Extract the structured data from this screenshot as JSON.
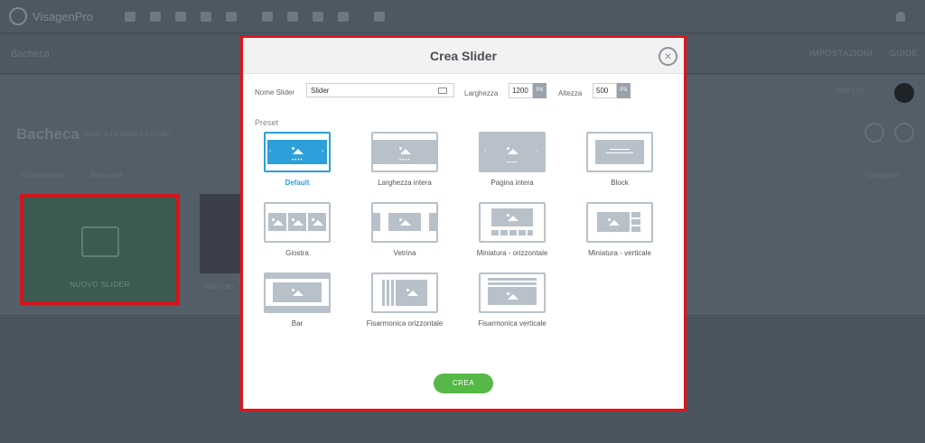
{
  "app": {
    "logo_text": "VisagenPro",
    "breadcrumb": "Bacheca",
    "header_right": [
      "IMPOSTAZIONI",
      "GUIDE"
    ]
  },
  "background": {
    "page_title": "Bacheca",
    "page_subtitle": "Version 3.4.8 (ORATI) 3.0 [TBL]",
    "filters": [
      "Ordinamento",
      "Selezione"
    ],
    "filter_right": "Categorie",
    "right_label": "EMPLOI",
    "new_slider_label": "NUOVO SLIDER",
    "slide_caption": "Slider | Bb"
  },
  "modal": {
    "title": "Crea Slider",
    "name_label": "Nome Slider",
    "name_value": "Slider",
    "width_label": "Larghezza",
    "width_value": "1200",
    "height_label": "Altezza",
    "height_value": "500",
    "unit": "PX",
    "preset_label": "Preset",
    "presets": [
      {
        "name": "Default",
        "selected": true
      },
      {
        "name": "Larghezza intera",
        "selected": false
      },
      {
        "name": "Pagina intera",
        "selected": false
      },
      {
        "name": "Block",
        "selected": false
      },
      {
        "name": "Giostra",
        "selected": false
      },
      {
        "name": "Vetrina",
        "selected": false
      },
      {
        "name": "Miniatura - orizzontale",
        "selected": false
      },
      {
        "name": "Miniatura - verticale",
        "selected": false
      },
      {
        "name": "Bar",
        "selected": false
      },
      {
        "name": "Fisarmonica orizzontale",
        "selected": false
      },
      {
        "name": "Fisarmonica verticale",
        "selected": false
      }
    ],
    "create_button": "CREA",
    "close_icon": "close-icon"
  },
  "colors": {
    "accent": "#2d9fd9",
    "create": "#56b847",
    "highlight": "#e0141c"
  }
}
